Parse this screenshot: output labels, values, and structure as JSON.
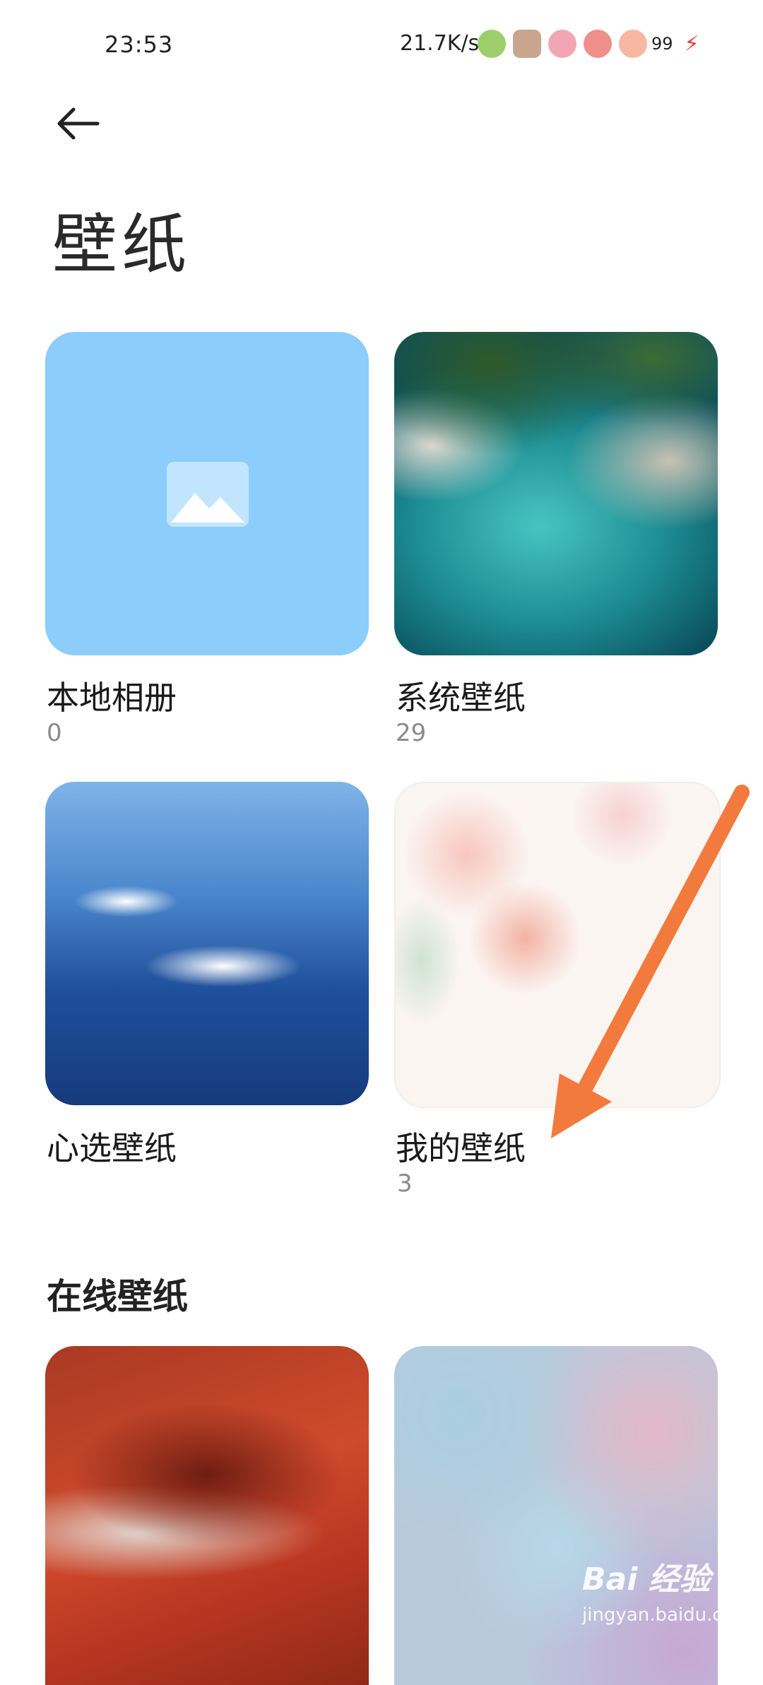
{
  "status_bar": {
    "time": "23:53",
    "net_speed": "21.7K/s",
    "battery_level": "99",
    "icons": [
      "frog-sticker-icon",
      "hamster-sticker-icon",
      "hd-signal-icon",
      "grapefruit-sticker-icon",
      "peach-battery-icon",
      "charging-icon"
    ]
  },
  "header": {
    "back_icon": "arrow-left-icon",
    "title": "壁纸"
  },
  "albums": [
    {
      "name": "本地相册",
      "count": "0"
    },
    {
      "name": "系统壁纸",
      "count": "29"
    },
    {
      "name": "心选壁纸",
      "count": ""
    },
    {
      "name": "我的壁纸",
      "count": "3"
    }
  ],
  "online_section": {
    "title": "在线壁纸"
  },
  "annotation": {
    "arrow_color": "#f27a3c"
  },
  "watermark": {
    "main": "Bai 经验",
    "sub": "jingyan.baidu.com"
  },
  "colors": {
    "local_album": "#8ccdfc",
    "text": "#1a1a1a",
    "count_text": "#8a8a8a"
  }
}
